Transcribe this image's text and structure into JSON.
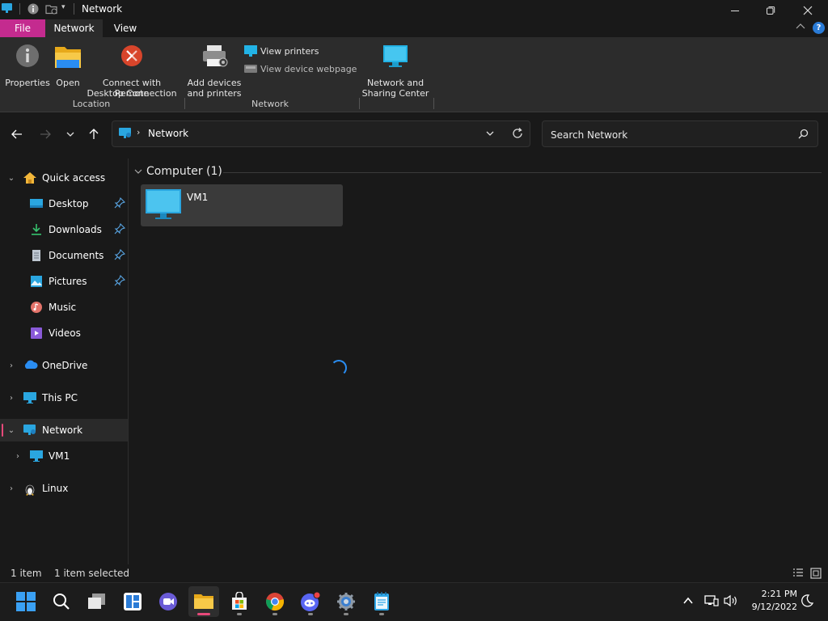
{
  "titlebar": {
    "title": "Network"
  },
  "ribbon_tabs": [
    {
      "label": "File"
    },
    {
      "label": "Network"
    },
    {
      "label": "View"
    }
  ],
  "ribbon": {
    "properties": "Properties",
    "open": "Open",
    "remote_line1": "Connect with Remote",
    "remote_line2": "Desktop Connection",
    "add_line1": "Add devices",
    "add_line2": "and printers",
    "view_printers": "View printers",
    "view_device_webpage": "View device webpage",
    "nsc_line1": "Network and",
    "nsc_line2": "Sharing Center",
    "group_location": "Location",
    "group_network": "Network"
  },
  "address": {
    "crumb": "Network",
    "search_placeholder": "Search Network"
  },
  "nav": {
    "quick_access": "Quick access",
    "desktop": "Desktop",
    "downloads": "Downloads",
    "documents": "Documents",
    "pictures": "Pictures",
    "music": "Music",
    "videos": "Videos",
    "onedrive": "OneDrive",
    "this_pc": "This PC",
    "network": "Network",
    "vm1": "VM1",
    "linux": "Linux"
  },
  "content": {
    "group_header": "Computer (1)",
    "items": [
      {
        "name": "VM1"
      }
    ]
  },
  "status": {
    "count": "1 item",
    "selected": "1 item selected"
  },
  "clock": {
    "time": "2:21 PM",
    "date": "9/12/2022"
  },
  "colors": {
    "file_tab": "#c42b8f",
    "accent": "#2a8df2",
    "active_indicator": "#e7497a"
  }
}
